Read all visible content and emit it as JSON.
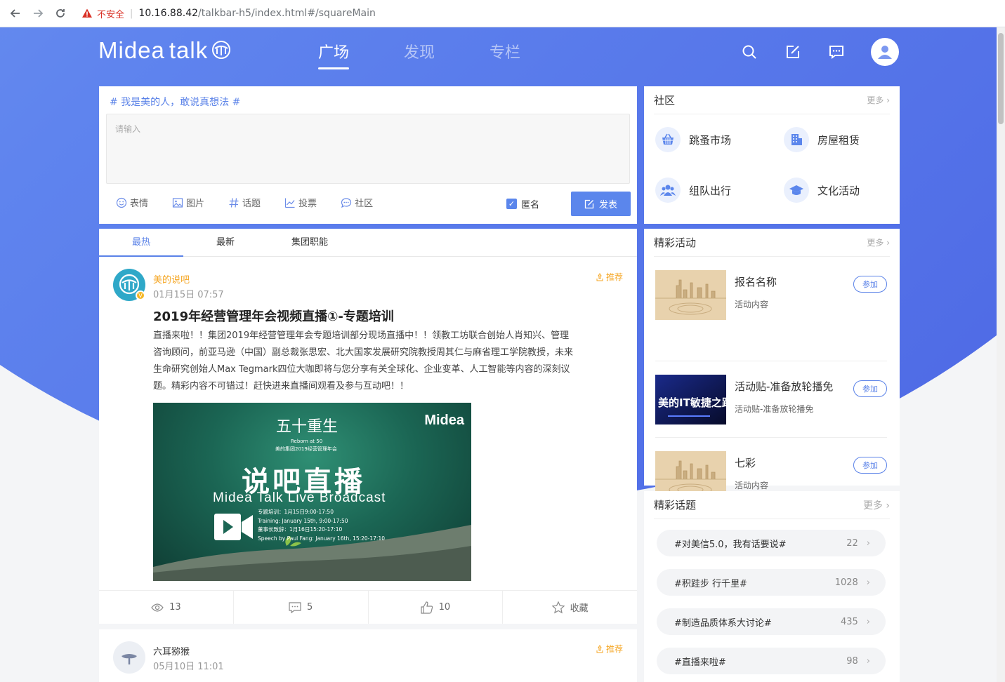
{
  "browser": {
    "insecure_label": "不安全",
    "url_host": "10.16.88.42",
    "url_path": "/talkbar-h5/index.html#/squareMain"
  },
  "header": {
    "logo_main": "Midea",
    "logo_talk": "talk",
    "tabs": [
      {
        "label": "广场",
        "active": true
      },
      {
        "label": "发现",
        "active": false
      },
      {
        "label": "专栏",
        "active": false
      }
    ]
  },
  "composer": {
    "hashtag": "# 我是美的人，敢说真想法 #",
    "placeholder": "请输入",
    "tools": [
      {
        "label": "表情",
        "icon": "smile-icon"
      },
      {
        "label": "图片",
        "icon": "image-icon"
      },
      {
        "label": "话题",
        "icon": "hash-icon"
      },
      {
        "label": "投票",
        "icon": "chart-icon"
      },
      {
        "label": "社区",
        "icon": "chat-icon"
      }
    ],
    "anonymous_label": "匿名",
    "anonymous_checked": true,
    "publish_label": "发表"
  },
  "feed": {
    "tabs": [
      {
        "label": "最热",
        "active": true
      },
      {
        "label": "最新",
        "active": false
      },
      {
        "label": "集团职能",
        "active": false
      }
    ],
    "post1": {
      "author": "美的说吧",
      "time": "01月15日 07:57",
      "badge": "推荐",
      "title": "2019年经营管理年会视频直播①-专题培训",
      "body": "直播来啦！！集团2019年经营管理年会专题培训部分现场直播中！！领教工坊联合创始人肖知兴、管理咨询顾问，前亚马逊（中国）副总裁张思宏、北大国家发展研究院教授周其仁与麻省理工学院教授，未来生命研究创始人Max Tegmark四位大咖即将与您分享有关全球化、企业变革、人工智能等内容的深刻议题。精彩内容不可错过！赶快进来直播间观看及参与互动吧！！",
      "image": {
        "title_cn": "五十重生",
        "reborn": "Reborn at 50",
        "subtitle": "美的集团2019经营管理年会",
        "brand": "Midea",
        "main_cn": "说吧直播",
        "main_en": "Midea Talk Live Broadcast",
        "schedule": [
          "专题培训：1月15日9:00-17:50",
          "Training: January 15th, 9:00-17:50",
          "董事长致辞：1月16日15:20-17:10",
          "Speech by Paul Fang: January 16th, 15:20-17:10"
        ]
      },
      "views": "13",
      "comments": "5",
      "likes": "10",
      "favorite_label": "收藏"
    },
    "post2": {
      "author": "六耳猕猴",
      "time": "05月10日 11:01",
      "badge": "推荐"
    }
  },
  "community": {
    "title": "社区",
    "more": "更多",
    "items": [
      {
        "label": "跳蚤市场",
        "icon": "basket-icon"
      },
      {
        "label": "房屋租赁",
        "icon": "building-icon"
      },
      {
        "label": "组队出行",
        "icon": "group-icon"
      },
      {
        "label": "文化活动",
        "icon": "graduation-cap-icon"
      }
    ]
  },
  "activities": {
    "title": "精彩活动",
    "more": "更多",
    "join_label": "参加",
    "items": [
      {
        "title": "报名名称",
        "desc": "活动内容"
      },
      {
        "title": "活动贴-准备放轮播免",
        "desc": "活动贴-准备放轮播免",
        "thumb_text": "美的IT敏捷之路"
      },
      {
        "title": "七彩",
        "desc": "活动内容"
      }
    ]
  },
  "topics": {
    "title": "精彩话题",
    "more": "更多",
    "items": [
      {
        "label": "#对美信5.0，我有话要说#",
        "count": "22"
      },
      {
        "label": "#积跬步 行千里#",
        "count": "1028"
      },
      {
        "label": "#制造品质体系大讨论#",
        "count": "435"
      },
      {
        "label": "#直播来啦#",
        "count": "98"
      }
    ]
  }
}
